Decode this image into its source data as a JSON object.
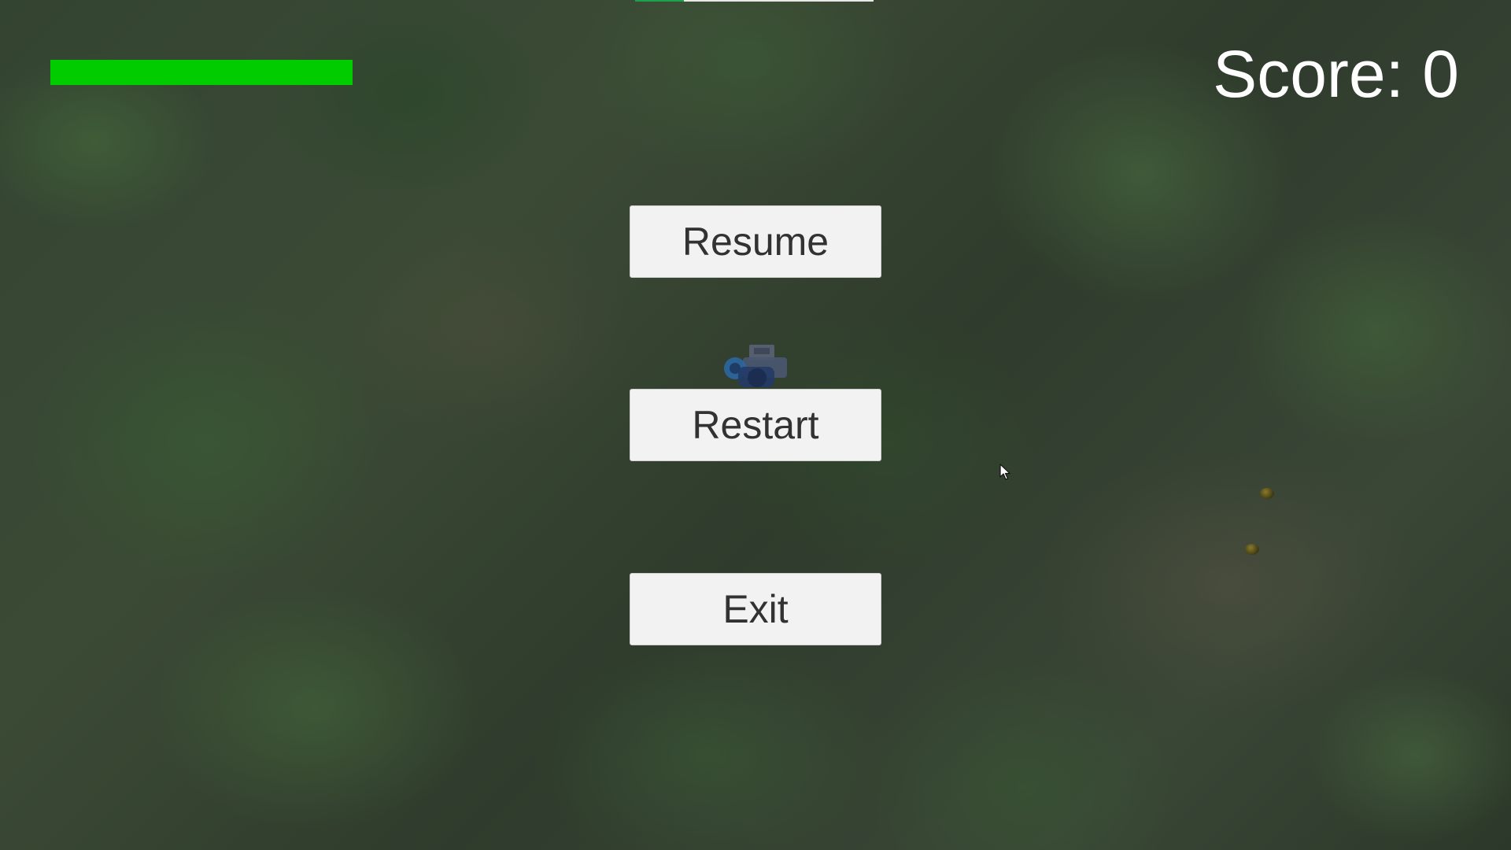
{
  "hud": {
    "score_text": "Score: 0",
    "health_fraction": 1.0,
    "health_color": "#00cc00"
  },
  "pause_menu": {
    "resume_label": "Resume",
    "restart_label": "Restart",
    "exit_label": "Exit"
  },
  "scene": {
    "player_icon": "tank-icon",
    "enemy_icons": [
      "enemy-projectile-icon",
      "enemy-projectile-icon"
    ],
    "cursor_icon": "cursor-icon"
  }
}
